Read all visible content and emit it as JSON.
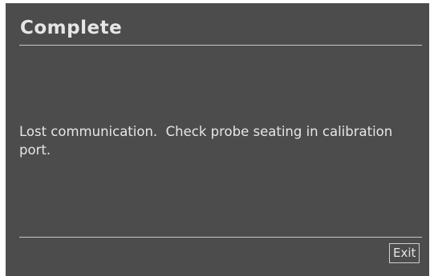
{
  "dialog": {
    "title": "Complete",
    "message": "Lost communication.  Check probe seating in calibration port.",
    "exit_label": "Exit"
  }
}
